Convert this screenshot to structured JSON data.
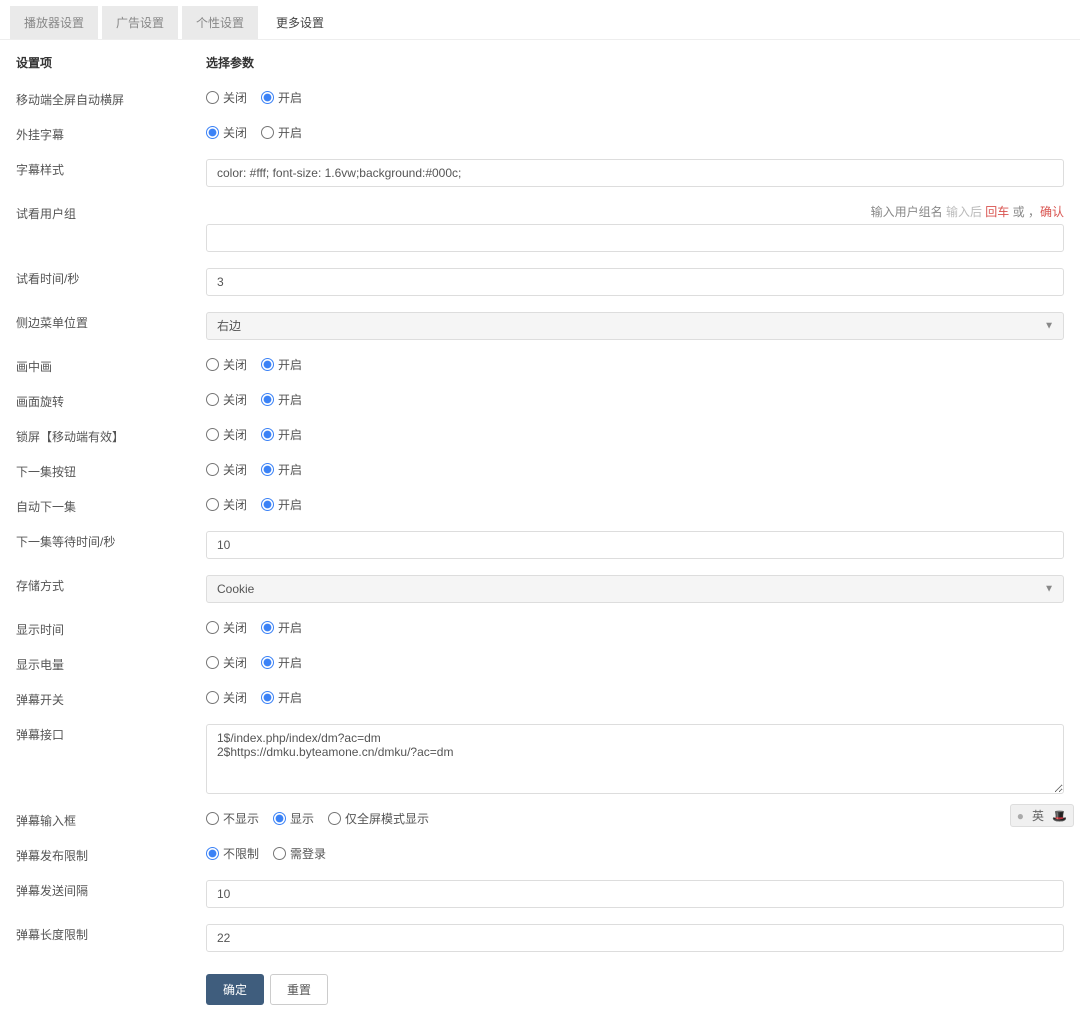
{
  "tabs": {
    "t0": "播放器设置",
    "t1": "广告设置",
    "t2": "个性设置",
    "t3": "更多设置"
  },
  "header": {
    "label": "设置项",
    "param": "选择参数"
  },
  "opts": {
    "off": "关闭",
    "on": "开启"
  },
  "rows": {
    "mobile_fullscreen": "移动端全屏自动横屏",
    "ext_subtitle": "外挂字幕",
    "subtitle_style": "字幕样式",
    "trial_group": "试看用户组",
    "trial_group_helper_prefix": "输入用户组名 ",
    "trial_group_helper_hint1": "输入后 ",
    "trial_group_helper_hl1": "回车",
    "trial_group_helper_mid": " 或 ，",
    "trial_group_helper_hl2": "确认",
    "trial_time": "试看时间/秒",
    "sidebar_pos": "侧边菜单位置",
    "pip": "画中画",
    "rotate": "画面旋转",
    "lock": "锁屏【移动端有效】",
    "next_btn": "下一集按钮",
    "auto_next": "自动下一集",
    "next_wait": "下一集等待时间/秒",
    "storage": "存储方式",
    "show_time": "显示时间",
    "show_battery": "显示电量",
    "danmu_switch": "弹幕开关",
    "danmu_api": "弹幕接口",
    "danmu_input": "弹幕输入框",
    "danmu_post": "弹幕发布限制",
    "danmu_interval": "弹幕发送间隔",
    "danmu_length": "弹幕长度限制"
  },
  "values": {
    "subtitle_style": "color: #fff; font-size: 1.6vw;background:#000c;",
    "trial_time": "3",
    "sidebar_pos": "右边",
    "next_wait": "10",
    "storage": "Cookie",
    "danmu_api": "1$/index.php/index/dm?ac=dm\n2$https://dmku.byteamone.cn/dmku/?ac=dm",
    "danmu_interval": "10",
    "danmu_length": "22"
  },
  "danmu_input_opts": {
    "hide": "不显示",
    "show": "显示",
    "fs": "仅全屏模式显示"
  },
  "danmu_post_opts": {
    "nolimit": "不限制",
    "login": "需登录"
  },
  "buttons": {
    "ok": "确定",
    "reset": "重置"
  },
  "ime": {
    "dot": "●",
    "lang": "英",
    "icon": "🎩"
  }
}
